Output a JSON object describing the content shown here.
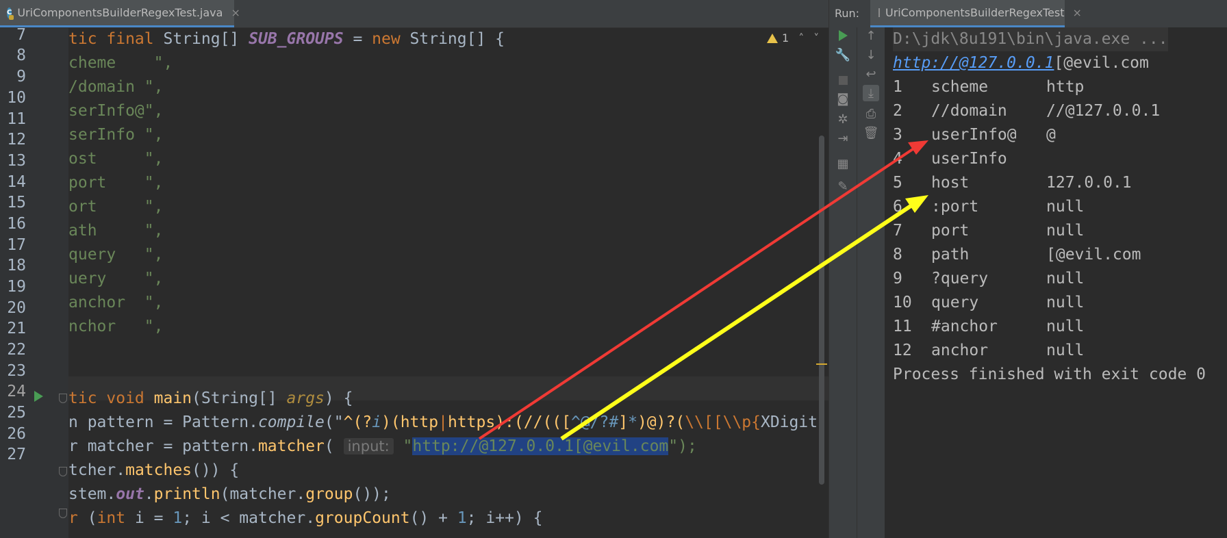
{
  "editor": {
    "tab_label": "UriComponentsBuilderRegexTest.java",
    "tab_close": "×",
    "warning_count": "1",
    "lines": [
      {
        "num": "7"
      },
      {
        "num": "8"
      },
      {
        "num": "9"
      },
      {
        "num": "10"
      },
      {
        "num": "11"
      },
      {
        "num": "12"
      },
      {
        "num": "13"
      },
      {
        "num": "14"
      },
      {
        "num": "15"
      },
      {
        "num": "16"
      },
      {
        "num": "17"
      },
      {
        "num": "18"
      },
      {
        "num": "19"
      },
      {
        "num": "20"
      },
      {
        "num": "21"
      },
      {
        "num": "22"
      },
      {
        "num": "23"
      },
      {
        "num": "24"
      },
      {
        "num": "25"
      },
      {
        "num": "26"
      },
      {
        "num": "27"
      }
    ],
    "code": {
      "l7_a": "tic final ",
      "l7_b": "String",
      "l7_c": "[] ",
      "l7_d": "SUB_GROUPS",
      "l7_e": " = ",
      "l7_f": "new ",
      "l7_g": "String",
      "l7_h": "[] {",
      "l8": "cheme    \",",
      "l9": "/domain \",",
      "l10": "serInfo@\",",
      "l11": "serInfo \",",
      "l12": "ost     \",",
      "l13": "port    \",",
      "l14": "ort     \",",
      "l15": "ath     \",",
      "l16": "query   \",",
      "l17": "uery    \",",
      "l18": "anchor  \",",
      "l19": "nchor   \",",
      "l22_a": "tic void ",
      "l22_b": "main",
      "l22_c": "(String[] ",
      "l22_d": "args",
      "l22_e": ") {",
      "l23_a": "n pattern = Pattern.",
      "l23_b": "compile",
      "l23_c": "(\"",
      "l23_r1": "^(?",
      "l23_r2": "i",
      "l23_r3": ")(http",
      "l23_r4": "|",
      "l23_r5": "https",
      "l23_r6": "):(//(([",
      "l23_r7": "^@/?#",
      "l23_r8": "]",
      "l23_r9": "*",
      "l23_r10": ")@)?(",
      "l23_r11": "\\\\[[\\\\p{",
      "l23_r12": "XDigit",
      "l24_a": "r matcher = pattern.",
      "l24_b": "matcher",
      "l24_c": "( ",
      "l24_hint": "input:",
      "l24_q": " \"",
      "l24_sel": "http://@127.0.0.1[@evil.com",
      "l24_end": "\");",
      "l25_a": "tcher.",
      "l25_b": "matches",
      "l25_c": "()) {",
      "l26_a": "stem.",
      "l26_b": "out",
      "l26_c": ".",
      "l26_d": "println",
      "l26_e": "(matcher.",
      "l26_f": "group",
      "l26_g": "());",
      "l27_a": "r ",
      "l27_b": "(",
      "l27_c": "int ",
      "l27_d": "i = ",
      "l27_e": "1",
      "l27_f": "; i < matcher.",
      "l27_g": "groupCount",
      "l27_h": "() + ",
      "l27_i": "1",
      "l27_j": "; i++) {"
    }
  },
  "run": {
    "label": "Run:",
    "tab_label": "UriComponentsBuilderRegexTest",
    "tab_close": "×",
    "toolbar_left": [
      "run-icon",
      "wrench-icon",
      "stop-icon",
      "camera-icon",
      "debug-icon",
      "exit-icon",
      "layout-icon",
      "pin-icon"
    ],
    "toolbar_right": [
      "up-arrow-icon",
      "down-arrow-icon",
      "soft-wrap-icon",
      "scroll-to-end-icon",
      "print-icon",
      "trash-icon"
    ],
    "command": "D:\\jdk\\8u191\\bin\\java.exe ...",
    "url_link": "http://@127.0.0.1",
    "url_rest": "[@evil.com",
    "groups": [
      {
        "idx": "1",
        "name": "scheme",
        "value": "http"
      },
      {
        "idx": "2",
        "name": "//domain",
        "value": "//@127.0.0.1"
      },
      {
        "idx": "3",
        "name": "userInfo@",
        "value": "@"
      },
      {
        "idx": "4",
        "name": "userInfo",
        "value": ""
      },
      {
        "idx": "5",
        "name": "host",
        "value": "127.0.0.1"
      },
      {
        "idx": "6",
        "name": ":port",
        "value": "null"
      },
      {
        "idx": "7",
        "name": "port",
        "value": "null"
      },
      {
        "idx": "8",
        "name": "path",
        "value": "[@evil.com"
      },
      {
        "idx": "9",
        "name": "?query",
        "value": "null"
      },
      {
        "idx": "10",
        "name": "query",
        "value": "null"
      },
      {
        "idx": "11",
        "name": "#anchor",
        "value": "null"
      },
      {
        "idx": "12",
        "name": "anchor",
        "value": "null"
      }
    ],
    "exit_message": "Process finished with exit code 0"
  },
  "colors": {
    "arrow_red": "#f03a35",
    "arrow_yellow": "#ffff1a"
  }
}
